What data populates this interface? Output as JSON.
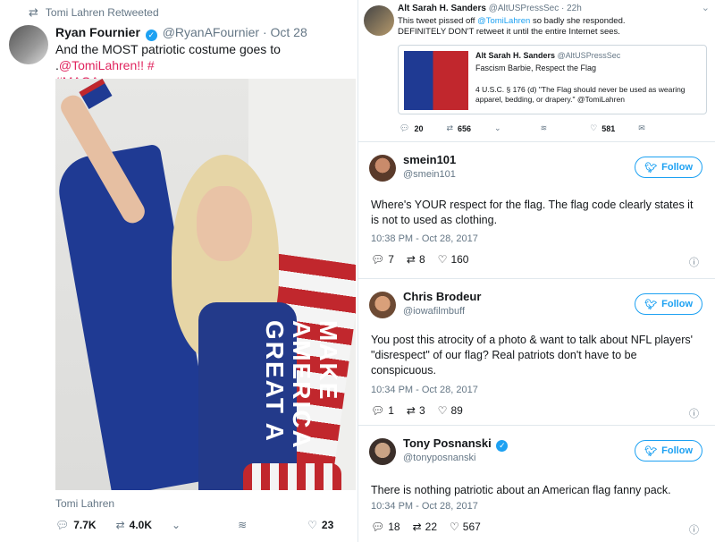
{
  "left_tweet": {
    "retweet_label": "Tomi Lahren Retweeted",
    "author_name": "Ryan Fournier",
    "author_handle": "@RyanAFournier",
    "date": "· Oct 28",
    "text_prefix": "And the MOST patriotic costume goes to .",
    "mention": "@TomiLahren",
    "text_suffix": "!! #",
    "hashtag": "#MAGA",
    "photo_text": "MAKE AMERICA GREAT A",
    "credit": "Tomi Lahren",
    "replies": "7.7K",
    "retweets": "4.0K",
    "likes": "23"
  },
  "top_right": {
    "author_name": "Alt Sarah H. Sanders",
    "author_handle": "@AltUSPressSec",
    "time": "· 22h",
    "text_a": "This tweet pissed off ",
    "mention": "@TomiLahren",
    "text_b": " so badly she responded.",
    "text_c": "DEFINITELY DON'T retweet it until the entire Internet sees.",
    "quote": {
      "author_name": "Alt Sarah H. Sanders",
      "author_handle": "@AltUSPressSec",
      "line1": "Fascism Barbie, Respect the Flag",
      "line2": "4 U.S.C. § 176 (d) \"The Flag should never be used as wearing apparel, bedding, or drapery.\" @TomiLahren"
    },
    "replies": "20",
    "retweets": "656",
    "likes": "581"
  },
  "replies": [
    {
      "name": "smein101",
      "handle": "@smein101",
      "verified": false,
      "follow_label": "Follow",
      "text": "Where's YOUR respect for the flag. The flag code clearly states it is not to used as clothing.",
      "time": "10:38 PM - Oct 28, 2017",
      "replies": "7",
      "retweets": "8",
      "likes": "160"
    },
    {
      "name": "Chris Brodeur",
      "handle": "@iowafilmbuff",
      "verified": false,
      "follow_label": "Follow",
      "text": "You post this atrocity of a photo & want to talk about NFL players' \"disrespect\" of our flag? Real patriots don't have to be conspicuous.",
      "time": "10:34 PM - Oct 28, 2017",
      "replies": "1",
      "retweets": "3",
      "likes": "89"
    },
    {
      "name": "Tony Posnanski",
      "handle": "@tonyposnanski",
      "verified": true,
      "follow_label": "Follow",
      "text": "There is nothing patriotic about an American flag fanny pack.",
      "time": "10:34 PM - Oct 28, 2017",
      "replies": "18",
      "retweets": "22",
      "likes": "567"
    }
  ],
  "colors": {
    "accent": "#1da1f2",
    "mention": "#e0245e",
    "muted": "#657786"
  }
}
